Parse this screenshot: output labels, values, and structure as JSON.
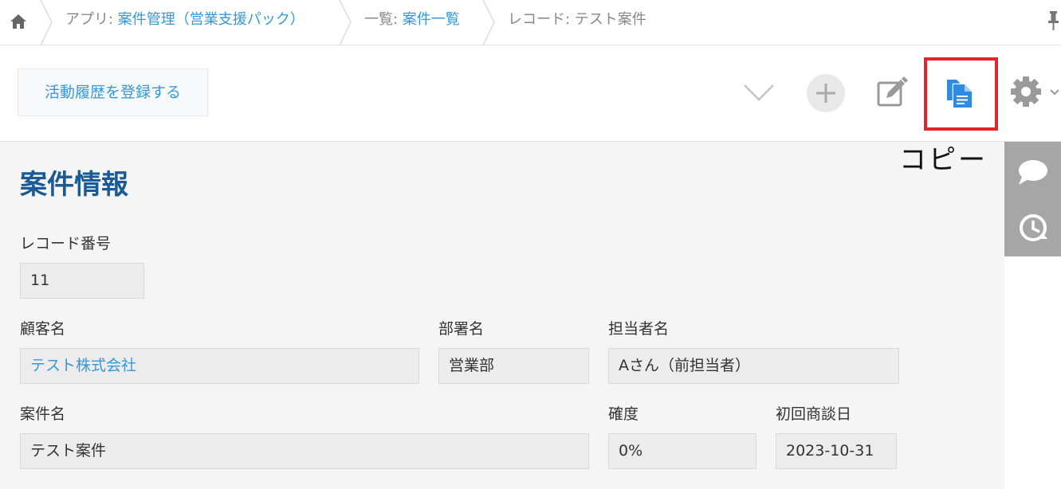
{
  "breadcrumb": {
    "app_prefix": "アプリ: ",
    "app_name": "案件管理（営業支援パック）",
    "view_prefix": "一覧: ",
    "view_name": "案件一覧",
    "record": "レコード: テスト案件"
  },
  "toolbar": {
    "activity_button_label": "活動履歴を登録する"
  },
  "tooltip": {
    "copy_label": "コピー"
  },
  "form": {
    "section_title": "案件情報",
    "record_number": {
      "label": "レコード番号",
      "value": "11"
    },
    "customer_name": {
      "label": "顧客名",
      "value": "テスト株式会社"
    },
    "department": {
      "label": "部署名",
      "value": "営業部"
    },
    "person_in_charge": {
      "label": "担当者名",
      "value": "Aさん（前担当者）"
    },
    "deal_name": {
      "label": "案件名",
      "value": "テスト案件"
    },
    "probability": {
      "label": "確度",
      "value": "0%"
    },
    "first_meeting_date": {
      "label": "初回商談日",
      "value": "2023-10-31"
    }
  },
  "colors": {
    "link": "#3498db",
    "section_title": "#1a5a96",
    "highlight": "#e3242b",
    "copy_icon": "#2f8ae0",
    "side_rail": "#a6a6a6"
  },
  "icons": [
    "home-icon",
    "pin-icon",
    "chevron-down-icon",
    "add-icon",
    "edit-icon",
    "copy-icon",
    "gear-icon",
    "comment-icon",
    "history-icon"
  ]
}
